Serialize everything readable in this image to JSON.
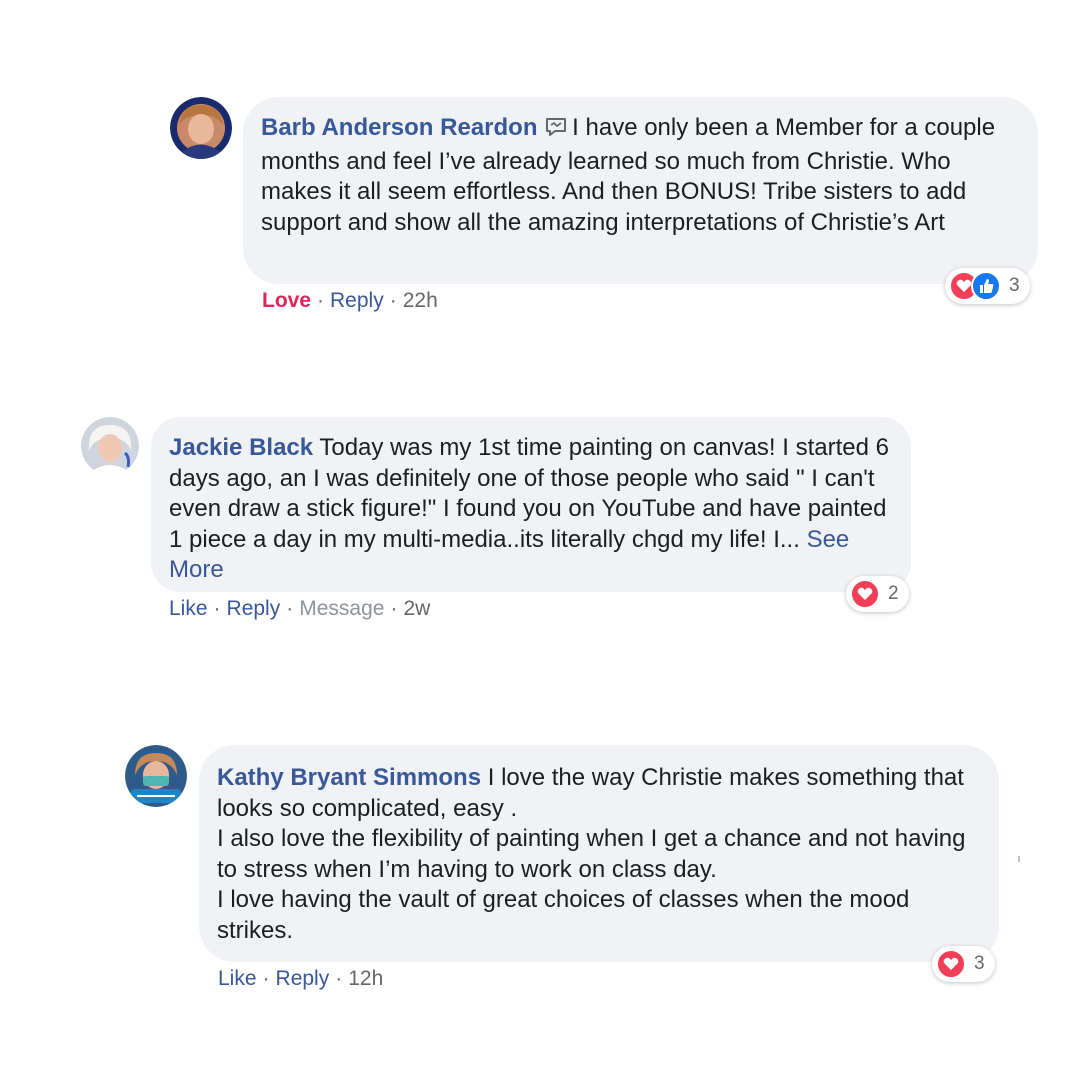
{
  "comments": [
    {
      "author": "Barb Anderson Reardon",
      "text": "I have only been a Member for a couple months and feel I’ve already learned so much from Christie. Who makes it all seem effortless. And then BONUS! Tribe sisters to add support and show all the amazing interpretations of Christie’s Art",
      "action_label": "Love",
      "reply_label": "Reply",
      "time": "22h",
      "reaction_count": "3",
      "badge_icon": "messenger-chat-icon",
      "reactions": [
        "love-reaction-icon",
        "like-reaction-icon"
      ]
    },
    {
      "author": "Jackie Black",
      "text": "Today was my 1st time painting on canvas! I started 6 days ago, an I was definitely one of those people who said \" I can't even draw a stick figure!\" I found you on YouTube and have painted 1 piece a day in my multi-media..its literally chgd my life! I...",
      "see_more": "See More",
      "action_label": "Like",
      "reply_label": "Reply",
      "message_label": "Message",
      "time": "2w",
      "reaction_count": "2",
      "reactions": [
        "love-reaction-icon"
      ]
    },
    {
      "author": "Kathy Bryant Simmons",
      "text_lines": [
        "I love the way Christie makes something that looks so complicated, easy .",
        "I also love the flexibility of painting when I get a chance and not having to stress when I’m having to work on class day.",
        "I love having the vault of great choices of classes when the mood strikes."
      ],
      "action_label": "Like",
      "reply_label": "Reply",
      "time": "12h",
      "reaction_count": "3",
      "reactions": [
        "love-reaction-icon"
      ]
    }
  ],
  "separator": "·",
  "colors": {
    "author": "#385898",
    "love": "#e0245e",
    "bubble": "#f0f2f5",
    "like_reaction": "#1877f2",
    "love_reaction": "#f33e58"
  }
}
